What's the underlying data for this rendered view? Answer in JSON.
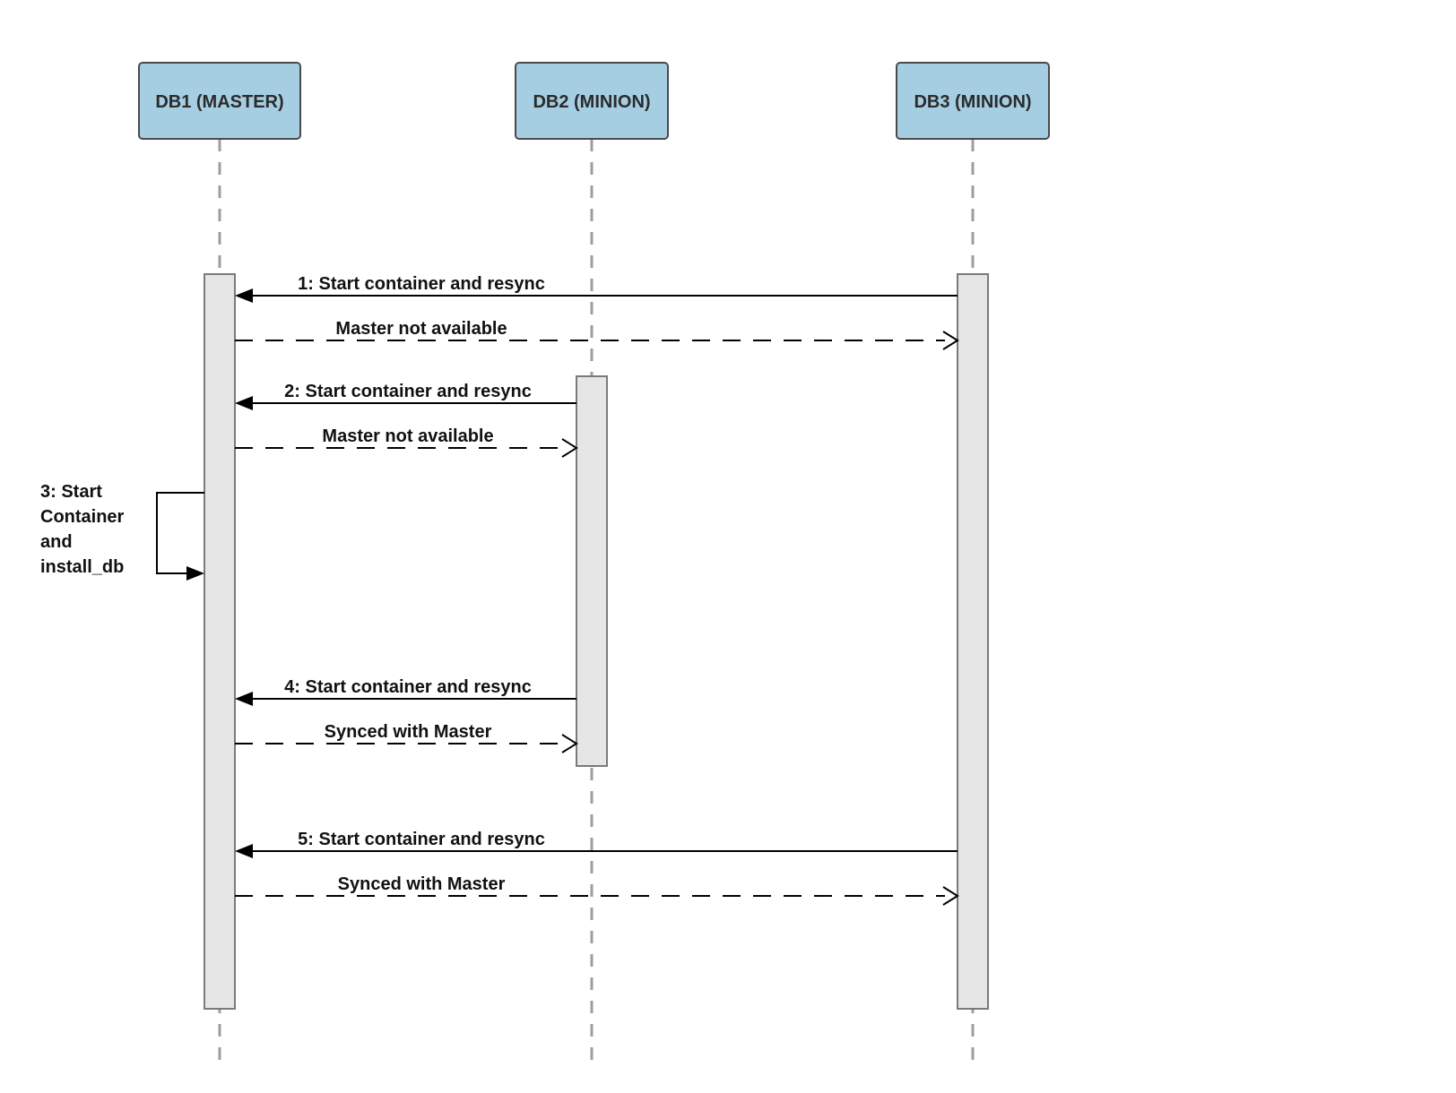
{
  "participants": {
    "db1": "DB1 (MASTER)",
    "db2": "DB2 (MINION)",
    "db3": "DB3 (MINION)"
  },
  "messages": {
    "m1": "1: Start container and resync",
    "r1": "Master not available",
    "m2": "2: Start container and resync",
    "r2": "Master not available",
    "m3": "3: Start Container and install_db",
    "m4": "4: Start container and resync",
    "r4": "Synced with Master",
    "m5": "5: Start container and resync",
    "r5": "Synced with Master"
  },
  "chart_data": {
    "type": "sequence-diagram",
    "participants": [
      {
        "id": "DB1",
        "label": "DB1 (MASTER)"
      },
      {
        "id": "DB2",
        "label": "DB2 (MINION)"
      },
      {
        "id": "DB3",
        "label": "DB3 (MINION)"
      }
    ],
    "interactions": [
      {
        "seq": 1,
        "from": "DB3",
        "to": "DB1",
        "action": "Start container and resync",
        "reply": "Master not available",
        "reply_style": "dashed"
      },
      {
        "seq": 2,
        "from": "DB2",
        "to": "DB1",
        "action": "Start container and resync",
        "reply": "Master not available",
        "reply_style": "dashed"
      },
      {
        "seq": 3,
        "from": "DB1",
        "to": "DB1",
        "action": "Start Container and install_db",
        "self": true
      },
      {
        "seq": 4,
        "from": "DB2",
        "to": "DB1",
        "action": "Start container and resync",
        "reply": "Synced with Master",
        "reply_style": "dashed"
      },
      {
        "seq": 5,
        "from": "DB3",
        "to": "DB1",
        "action": "Start container and resync",
        "reply": "Synced with Master",
        "reply_style": "dashed"
      }
    ]
  }
}
